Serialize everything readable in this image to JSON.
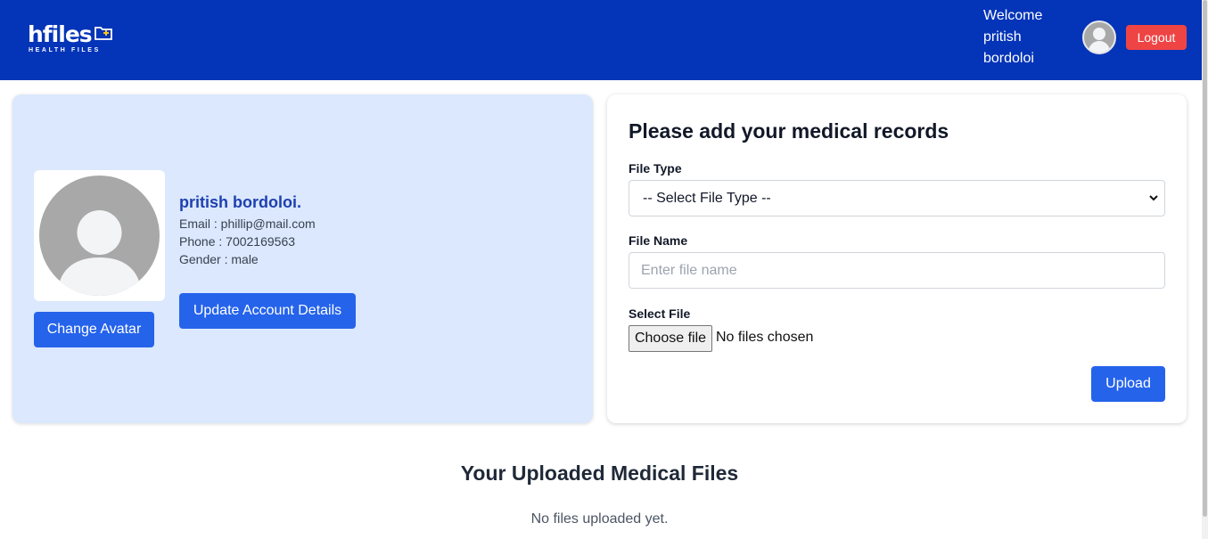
{
  "brand": {
    "name": "hfiles",
    "tagline": "HEALTH FILES",
    "primary_color": "#0434b8",
    "accent_color": "#f5c518"
  },
  "header": {
    "welcome_line1": "Welcome",
    "welcome_line2": "pritish",
    "welcome_line3": "bordoloi",
    "avatar_icon": "user-avatar-icon",
    "logout_label": "Logout"
  },
  "profile": {
    "name": "pritish bordoloi.",
    "email_line": "Email : phillip@mail.com",
    "phone_line": "Phone : 7002169563",
    "gender_line": "Gender : male",
    "change_avatar_label": "Change Avatar",
    "update_label": "Update Account Details"
  },
  "upload": {
    "title": "Please add your medical records",
    "file_type_label": "File Type",
    "file_type_selected": "-- Select File Type --",
    "file_name_label": "File Name",
    "file_name_placeholder": "Enter file name",
    "file_name_value": "",
    "select_file_label": "Select File",
    "choose_file_label": "Choose file",
    "no_file_text": "No files chosen",
    "upload_label": "Upload"
  },
  "files": {
    "title": "Your Uploaded Medical Files",
    "empty_text": "No files uploaded yet."
  }
}
